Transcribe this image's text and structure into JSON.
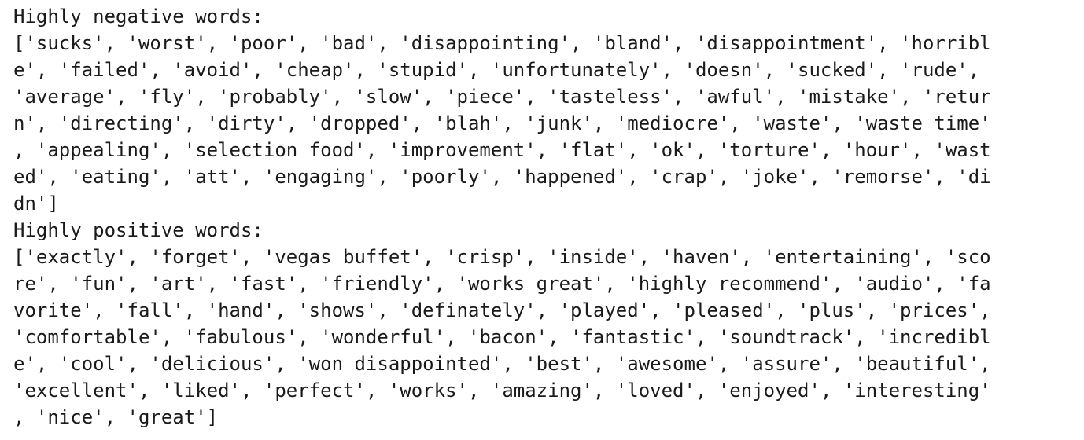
{
  "output": {
    "negative_header": "Highly negative words:",
    "negative_lines": [
      "['sucks', 'worst', 'poor', 'bad', 'disappointing', 'bland', 'disappointment', 'horribl",
      "e', 'failed', 'avoid', 'cheap', 'stupid', 'unfortunately', 'doesn', 'sucked', 'rude',",
      "'average', 'fly', 'probably', 'slow', 'piece', 'tasteless', 'awful', 'mistake', 'retur",
      "n', 'directing', 'dirty', 'dropped', 'blah', 'junk', 'mediocre', 'waste', 'waste time'",
      ", 'appealing', 'selection food', 'improvement', 'flat', 'ok', 'torture', 'hour', 'wast",
      "ed', 'eating', 'att', 'engaging', 'poorly', 'happened', 'crap', 'joke', 'remorse', 'di",
      "dn']"
    ],
    "positive_header": "Highly positive words:",
    "positive_lines": [
      "['exactly', 'forget', 'vegas buffet', 'crisp', 'inside', 'haven', 'entertaining', 'sco",
      "re', 'fun', 'art', 'fast', 'friendly', 'works great', 'highly recommend', 'audio', 'fa",
      "vorite', 'fall', 'hand', 'shows', 'definately', 'played', 'pleased', 'plus', 'prices',",
      "'comfortable', 'fabulous', 'wonderful', 'bacon', 'fantastic', 'soundtrack', 'incredibl",
      "e', 'cool', 'delicious', 'won disappointed', 'best', 'awesome', 'assure', 'beautiful',",
      "'excellent', 'liked', 'perfect', 'works', 'amazing', 'loved', 'enjoyed', 'interesting'",
      ", 'nice', 'great']"
    ]
  }
}
